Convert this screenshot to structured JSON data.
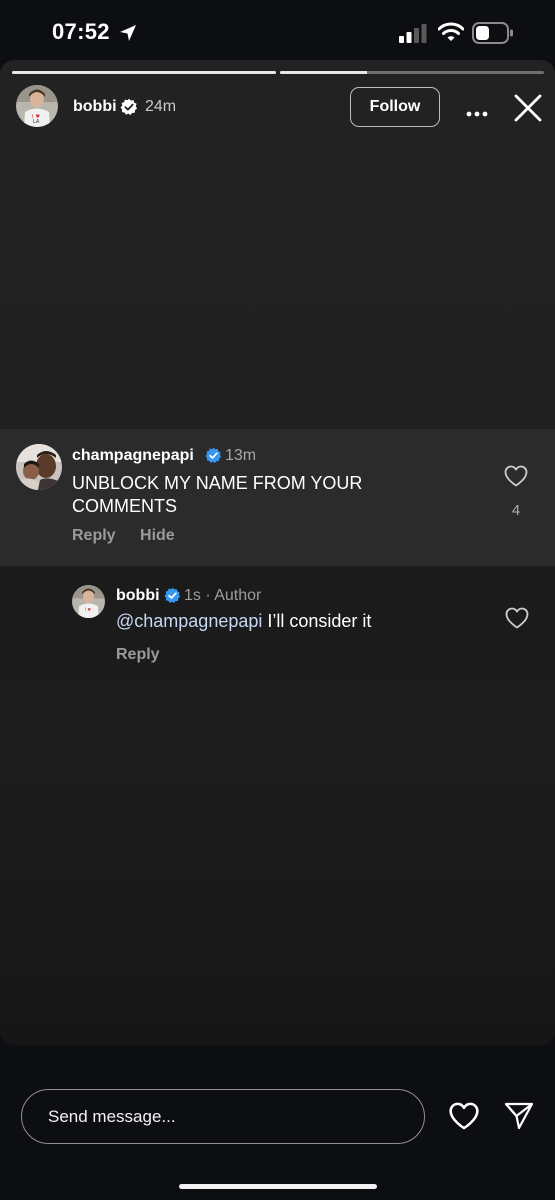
{
  "status_bar": {
    "time": "07:52"
  },
  "story": {
    "progress": [
      1.0,
      0.33
    ],
    "header": {
      "username": "bobbi",
      "time": "24m",
      "follow_label": "Follow"
    }
  },
  "comments": {
    "main": {
      "username": "champagnepapi",
      "time": "13m",
      "text": "UNBLOCK MY NAME FROM YOUR COMMENTS",
      "reply_label": "Reply",
      "hide_label": "Hide",
      "like_count": "4"
    },
    "reply": {
      "username": "bobbi",
      "meta": "1s · Author",
      "mention": "@champagnepapi",
      "text": " I’ll consider it",
      "reply_label": "Reply"
    }
  },
  "bottom_bar": {
    "message_placeholder": "Send message..."
  },
  "colors": {
    "verified": "#3897f0",
    "background": "#0c0e12",
    "comment_highlight": "#2b2b2b",
    "reply_background": "#1b1b1b",
    "mention": "#c7d8f4"
  }
}
